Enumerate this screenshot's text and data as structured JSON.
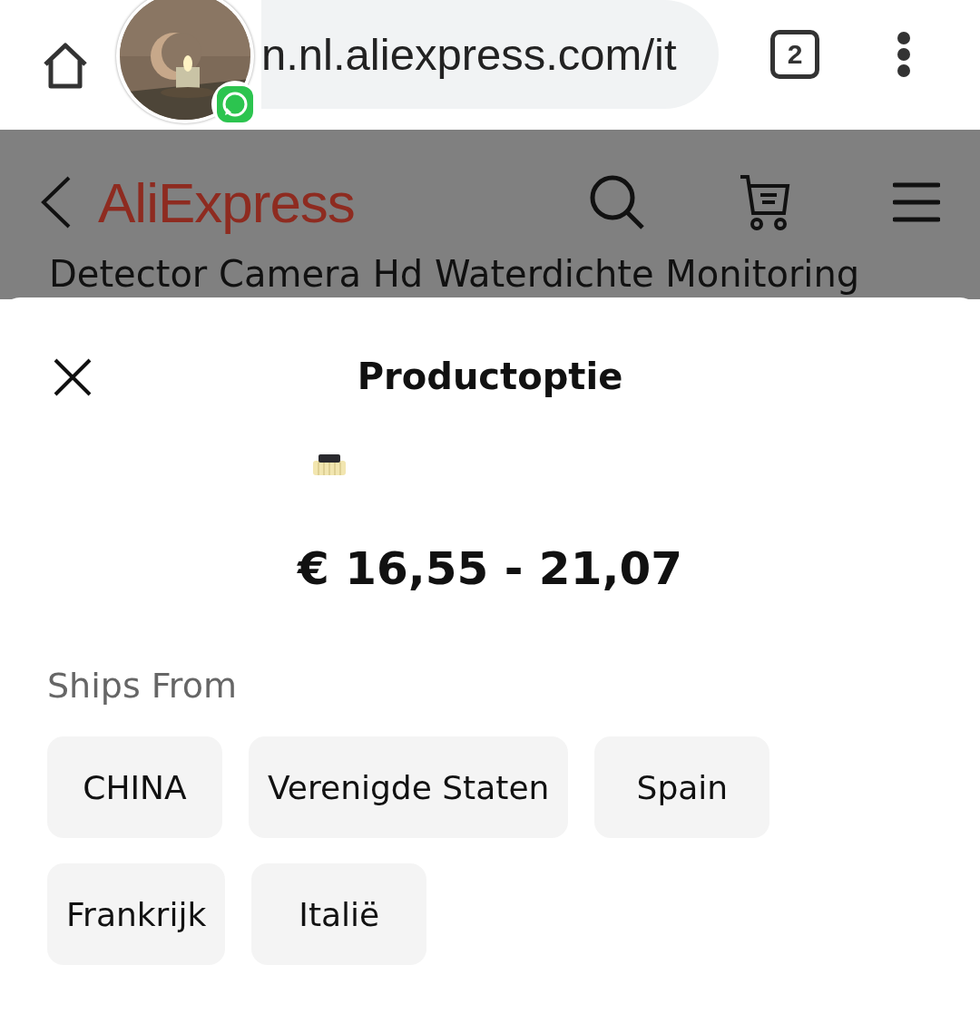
{
  "browser": {
    "url": "n.nl.aliexpress.com/it",
    "tab_count": "2"
  },
  "site_header": {
    "logo": "AliExpress",
    "title_partial": "Detector Camera Hd Waterdichte Monitoring"
  },
  "sheet": {
    "title": "Productoptie",
    "price": "€ 16,55 - 21,07",
    "section_label": "Ships From",
    "options": [
      {
        "label": "CHINA",
        "selected": false
      },
      {
        "label": "Verenigde Staten",
        "selected": false
      },
      {
        "label": "Spain",
        "selected": false
      },
      {
        "label": "Frankrijk",
        "selected": false
      },
      {
        "label": "Italië",
        "selected": false
      }
    ]
  }
}
